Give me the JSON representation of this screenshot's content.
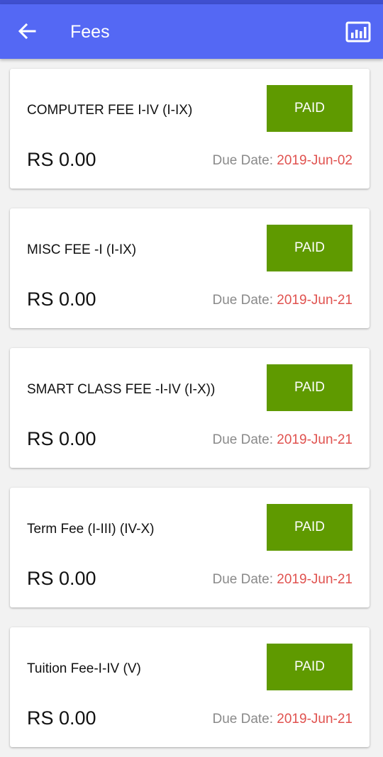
{
  "colors": {
    "app_bar": "#5468f4",
    "paid_button": "#5f9a00",
    "due_date": "#e0524f",
    "due_label": "#8a8a8a"
  },
  "header": {
    "title": "Fees",
    "back_icon": "arrow-left-icon",
    "chart_icon": "bar-chart-icon"
  },
  "fees": [
    {
      "name": "COMPUTER FEE I-IV (I-IX)",
      "status": "PAID",
      "amount": "RS 0.00",
      "due_label": "Due Date:",
      "due_date": "2019-Jun-02"
    },
    {
      "name": "MISC FEE -I (I-IX)",
      "status": "PAID",
      "amount": "RS 0.00",
      "due_label": "Due Date:",
      "due_date": "2019-Jun-21"
    },
    {
      "name": "SMART CLASS FEE -I-IV (I-X))",
      "status": "PAID",
      "amount": "RS 0.00",
      "due_label": "Due Date:",
      "due_date": "2019-Jun-21"
    },
    {
      "name": "Term Fee (I-III) (IV-X)",
      "status": "PAID",
      "amount": "RS 0.00",
      "due_label": "Due Date:",
      "due_date": "2019-Jun-21"
    },
    {
      "name": "Tuition Fee-I-IV (V)",
      "status": "PAID",
      "amount": "RS 0.00",
      "due_label": "Due Date:",
      "due_date": "2019-Jun-21"
    }
  ]
}
